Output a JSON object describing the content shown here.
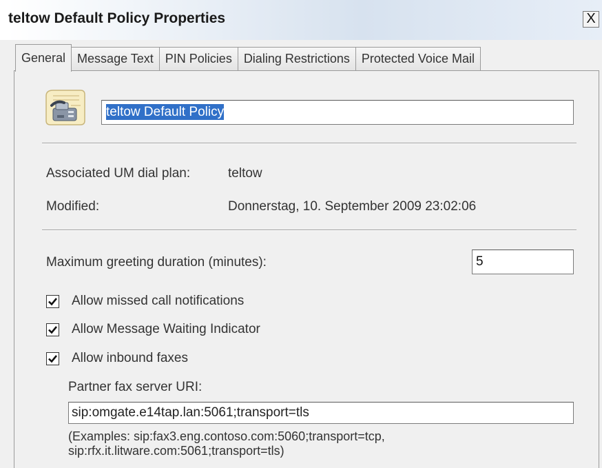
{
  "window": {
    "title": "teltow Default Policy Properties",
    "close_glyph": "X"
  },
  "tabs": [
    {
      "label": "General",
      "active": true
    },
    {
      "label": "Message Text",
      "active": false
    },
    {
      "label": "PIN Policies",
      "active": false
    },
    {
      "label": "Dialing Restrictions",
      "active": false
    },
    {
      "label": "Protected Voice Mail",
      "active": false
    }
  ],
  "general": {
    "icon": "fax-document-icon",
    "policy_name": "teltow Default Policy",
    "dial_plan_label": "Associated UM dial plan:",
    "dial_plan_value": "teltow",
    "modified_label": "Modified:",
    "modified_value": "Donnerstag, 10. September 2009 23:02:06",
    "greeting_label": "Maximum greeting duration (minutes):",
    "greeting_value": "5",
    "checkboxes": [
      {
        "label": "Allow missed call notifications",
        "checked": true
      },
      {
        "label": "Allow Message Waiting Indicator",
        "checked": true
      },
      {
        "label": "Allow inbound faxes",
        "checked": true
      }
    ],
    "fax_uri_label": "Partner fax server URI:",
    "fax_uri_value": "sip:omgate.e14tap.lan:5061;transport=tls",
    "examples_line1": "(Examples: sip:fax3.eng.contoso.com:5060;transport=tcp,",
    "examples_line2": "sip:rfx.it.litware.com:5061;transport=tls)"
  },
  "colors": {
    "selection": "#3070c8",
    "dialog_bg": "#f0f0f0"
  }
}
